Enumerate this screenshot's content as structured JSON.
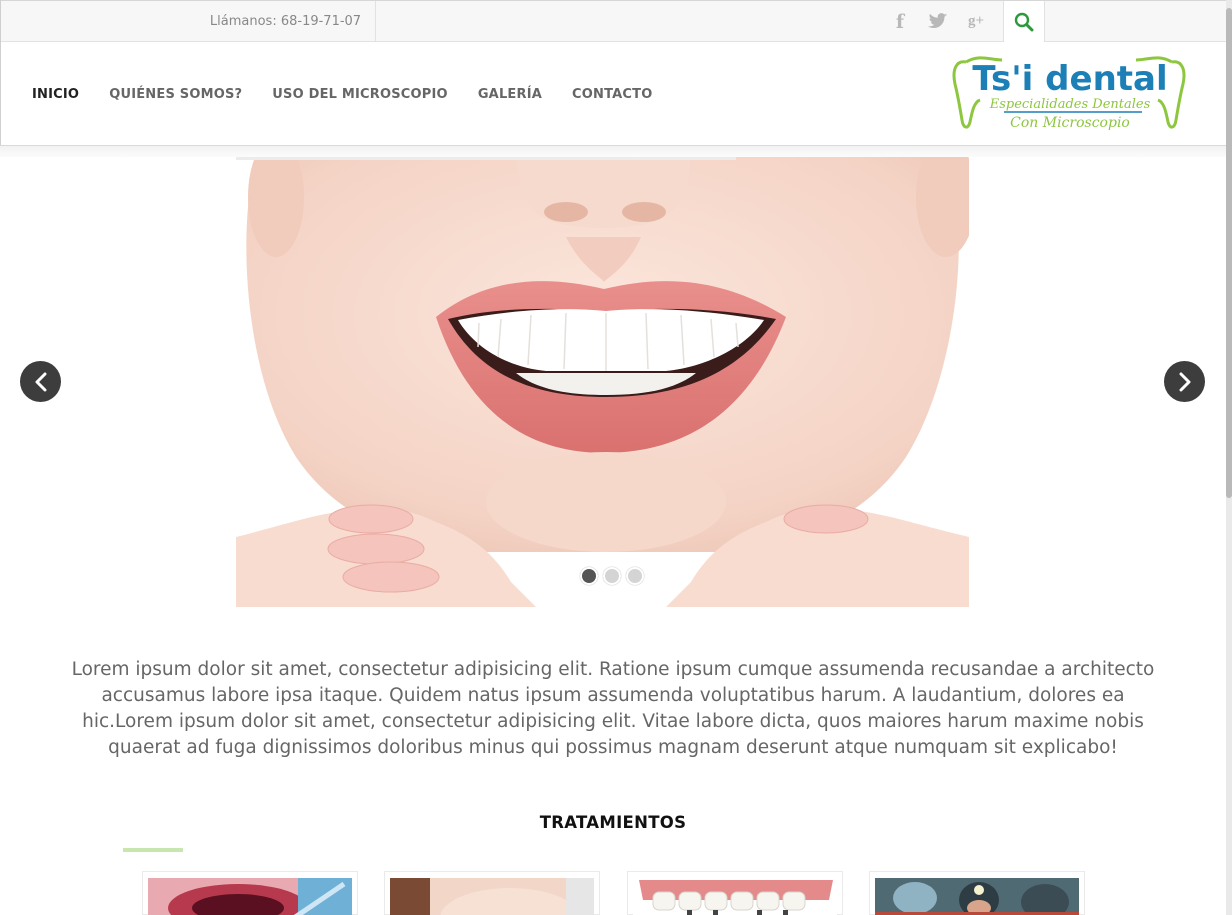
{
  "topbar": {
    "phone": "Llámanos: 68-19-71-07",
    "social": [
      {
        "name": "facebook",
        "glyph": "f"
      },
      {
        "name": "twitter",
        "glyph": "t"
      },
      {
        "name": "google-plus",
        "glyph": "g+"
      }
    ]
  },
  "nav": {
    "items": [
      {
        "label": "INICIO",
        "active": true
      },
      {
        "label": "QUIÉNES SOMOS?",
        "active": false
      },
      {
        "label": "USO DEL MICROSCOPIO",
        "active": false
      },
      {
        "label": "GALERÍA",
        "active": false
      },
      {
        "label": "CONTACTO",
        "active": false
      }
    ]
  },
  "logo": {
    "title": "Ts'i dental",
    "line1": "Especialidades Dentales",
    "line2": "Con Microscopio"
  },
  "slider": {
    "slide_count": 3,
    "active_index": 0
  },
  "intro": {
    "text": "Lorem ipsum dolor sit amet, consectetur adipisicing elit. Ratione ipsum cumque assumenda recusandae a architecto accusamus labore ipsa itaque. Quidem natus ipsum assumenda voluptatibus harum. A laudantium, dolores ea hic.Lorem ipsum dolor sit amet, consectetur adipisicing elit. Vitae labore dicta, quos maiores harum maxime nobis quaerat ad fuga dignissimos doloribus minus qui possimus magnam deserunt atque numquam sit explicabo!"
  },
  "treatments": {
    "title": "TRATAMIENTOS"
  },
  "colors": {
    "accent_green": "#8dc63f",
    "logo_blue": "#1c7fb6",
    "search_green": "#2c9a3c",
    "arrow_bg": "#3d3d3d"
  }
}
